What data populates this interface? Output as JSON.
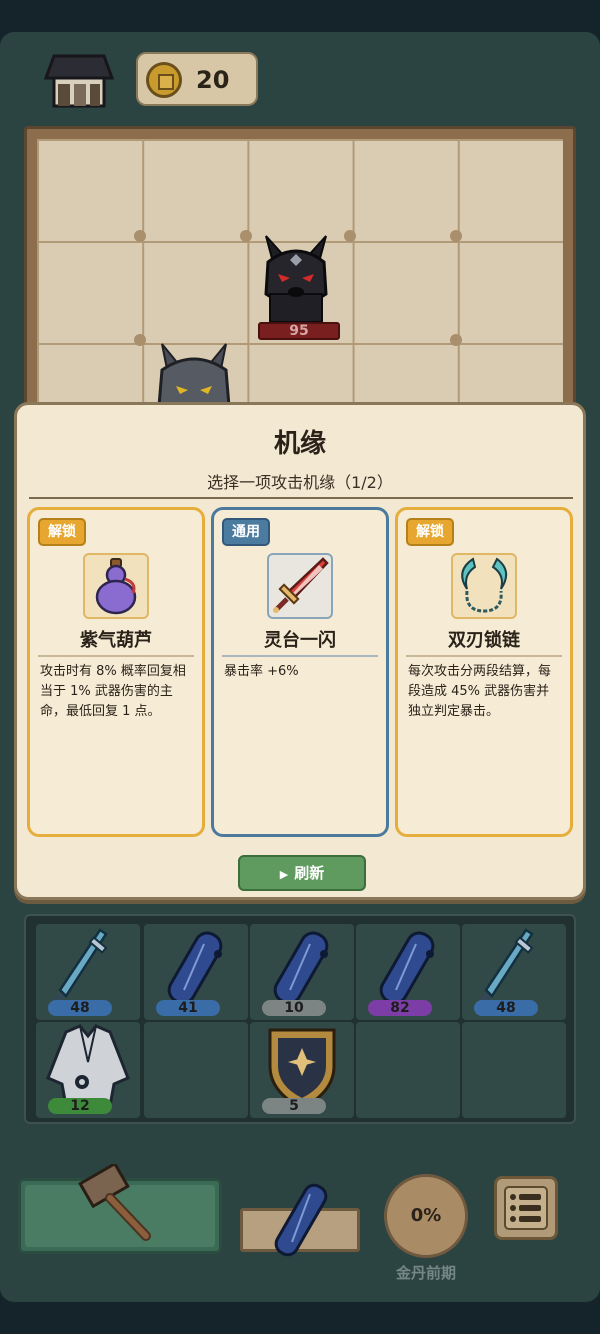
{
  "top_bar": {
    "home_icon": "house-icon",
    "coin_icon": "coin-icon",
    "coins": "20"
  },
  "board": {
    "enemy_hp": "95",
    "enemy_icon": "black-wolf-icon",
    "player_icon": "gray-wolf-icon"
  },
  "modal": {
    "title": "机缘",
    "subtitle": "选择一项攻击机缘（1/2）",
    "cards": [
      {
        "badge": "解锁",
        "name": "紫气葫芦",
        "icon": "purple-gourd-icon",
        "desc": "攻击时有 8% 概率回复相当于 1% 武器伤害的主命，最低回复 1 点。"
      },
      {
        "badge": "通用",
        "name": "灵台一闪",
        "icon": "red-sword-icon",
        "desc": "暴击率 +6%"
      },
      {
        "badge": "解锁",
        "name": "双刃锁链",
        "icon": "chain-blades-icon",
        "desc": "每次攻击分两段结算，每段造成 45% 武器伤害并独立判定暴击。"
      }
    ],
    "refresh_label": "刷新"
  },
  "inventory": {
    "slots": [
      {
        "item": "sword-icon",
        "level": "48",
        "tier": "blue"
      },
      {
        "item": "scroll-icon",
        "level": "41",
        "tier": "blue"
      },
      {
        "item": "scroll-icon",
        "level": "10",
        "tier": "gray"
      },
      {
        "item": "scroll-icon",
        "level": "82",
        "tier": "purple"
      },
      {
        "item": "sword-icon",
        "level": "48",
        "tier": "blue"
      },
      {
        "item": "robe-icon",
        "level": "12",
        "tier": "green"
      },
      {
        "item": "empty",
        "level": "",
        "tier": ""
      },
      {
        "item": "shield-icon",
        "level": "5",
        "tier": "gray"
      },
      {
        "item": "empty",
        "level": "",
        "tier": ""
      },
      {
        "item": "empty",
        "level": "",
        "tier": ""
      }
    ]
  },
  "bottom_bar": {
    "forge_icon": "hammer-icon",
    "anvil_item": "scroll-icon",
    "progress": "0%",
    "stage": "金丹前期",
    "menu_icon": "list-icon"
  },
  "colors": {
    "badge_unlock": "#e6a62f",
    "badge_general": "#4c7ba0",
    "refresh_green": "#5f9a5e",
    "tier_blue": "#3a6da8",
    "tier_gray": "#7c8584",
    "tier_purple": "#7c3ea6",
    "tier_green": "#3d8a3b"
  }
}
